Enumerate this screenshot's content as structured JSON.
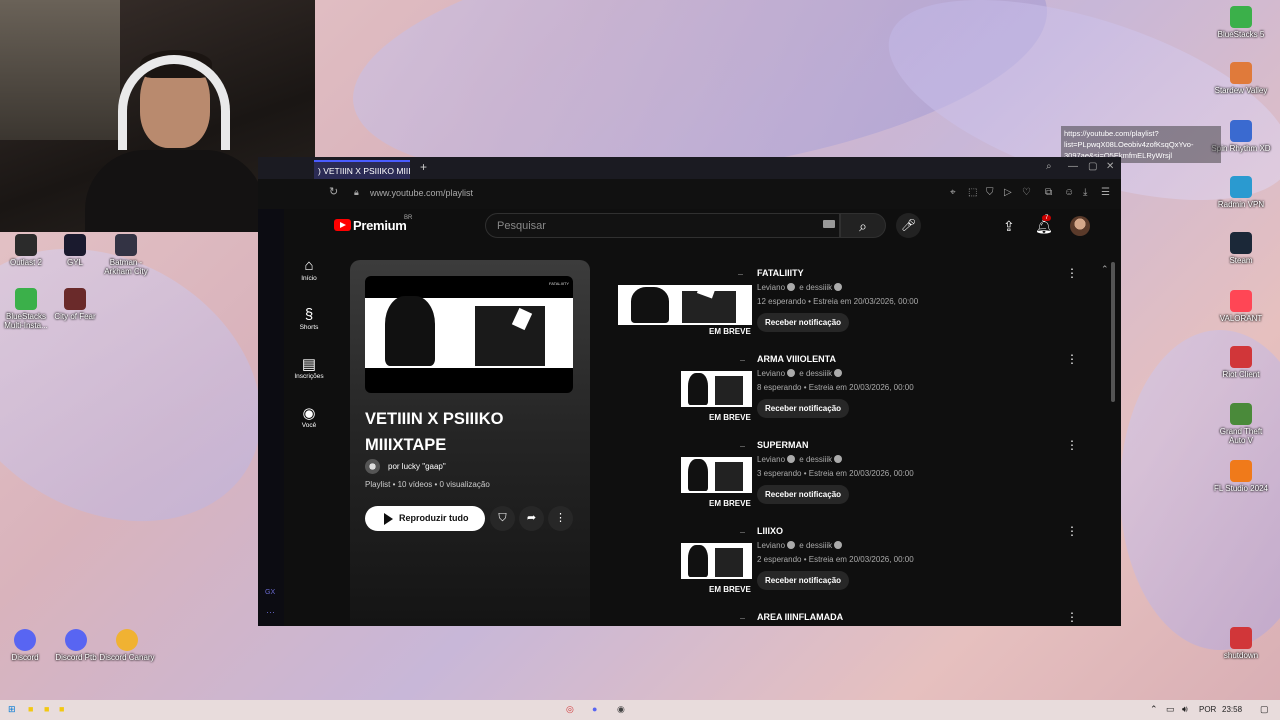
{
  "webcam": {
    "label": "webcam overlay"
  },
  "desktop_icons_left": [
    {
      "label": "Outlast 2",
      "icon": "outlast-icon",
      "color": "#2b2b2b"
    },
    {
      "label": "GYL",
      "icon": "gyl-icon",
      "color": "#1a1a2e"
    },
    {
      "label": "Batman - Arkham City",
      "icon": "batman-icon",
      "color": "#333344"
    },
    {
      "label": "BlueStacks Multi-Insta...",
      "icon": "bluestacks-icon",
      "color": "#3bb04a"
    },
    {
      "label": "City of Fear",
      "icon": "city-of-fear-icon",
      "color": "#6a2a2a"
    }
  ],
  "desktop_icons_left_bottom": [
    {
      "label": "Discord",
      "icon": "discord-icon",
      "color": "#5865f2"
    },
    {
      "label": "Discord Ptb",
      "icon": "discord-ptb-icon",
      "color": "#5865f2"
    },
    {
      "label": "Discord Canary",
      "icon": "discord-canary-icon",
      "color": "#f0b232"
    }
  ],
  "desktop_icons_right": [
    {
      "label": "BlueStacks 5",
      "icon": "bluestacks-icon",
      "color": "#3bb04a"
    },
    {
      "label": "Stardew Valley",
      "icon": "stardew-icon",
      "color": "#e07a3a"
    },
    {
      "label": "Spin Rhythm XD",
      "icon": "spin-rhythm-icon",
      "color": "#3a6ad0"
    },
    {
      "label": "Radmin VPN",
      "icon": "radmin-icon",
      "color": "#2a9ad0"
    },
    {
      "label": "Steam",
      "icon": "steam-icon",
      "color": "#1b2838"
    },
    {
      "label": "VALORANT",
      "icon": "valorant-icon",
      "color": "#ff4655"
    },
    {
      "label": "Riot Client",
      "icon": "riot-icon",
      "color": "#d13639"
    },
    {
      "label": "Grand Theft Auto V",
      "icon": "gta-icon",
      "color": "#4a8a3a"
    },
    {
      "label": "FL Studio 2024",
      "icon": "fl-studio-icon",
      "color": "#f07a1a"
    },
    {
      "label": "shutdown",
      "icon": "shutdown-icon",
      "color": "#d13639"
    }
  ],
  "browser": {
    "tab_title": ") VETIIIN X PSIIIKO MIIIX",
    "url": "www.youtube.com/playlist",
    "link_tooltip": "https://youtube.com/playlist?list=PLpwqX08LOeobiv4zofKsqQxYvo-3097ae&si=Q5EkmfmELRyWrsjl",
    "gx_label": "GX"
  },
  "yt": {
    "logo_text": "Premium",
    "logo_region": "BR",
    "search_placeholder": "Pesquisar",
    "notification_count": "7",
    "nav": [
      {
        "label": "Início",
        "icon": "home-icon"
      },
      {
        "label": "Shorts",
        "icon": "shorts-icon"
      },
      {
        "label": "Inscrições",
        "icon": "subscriptions-icon"
      },
      {
        "label": "Você",
        "icon": "you-icon"
      }
    ],
    "playlist": {
      "title": "VETIIIN X PSIIIKO MIIIXTAPE",
      "thumb_tag": "FATALIIITY",
      "owner": "por lucky \"gaap\"",
      "meta": "Playlist • 10 vídeos • 0 visualização",
      "play_all": "Reproduzir tudo"
    },
    "videos": [
      {
        "title": "FATALIIITY",
        "channel": "Leviano",
        "collab": "e dessiiik",
        "waiting": "12 esperando • Estreia em 20/03/2026, 00:00",
        "soon": "EM BREVE",
        "notify": "Receber notificação"
      },
      {
        "title": "ARMA VIIIOLENTA",
        "channel": "Leviano",
        "collab": "e dessiiik",
        "waiting": "8 esperando • Estreia em 20/03/2026, 00:00",
        "soon": "EM BREVE",
        "notify": "Receber notificação"
      },
      {
        "title": "SUPERMAN",
        "channel": "Leviano",
        "collab": "e dessiiik",
        "waiting": "3 esperando • Estreia em 20/03/2026, 00:00",
        "soon": "EM BREVE",
        "notify": "Receber notificação"
      },
      {
        "title": "LIIIXO",
        "channel": "Leviano",
        "collab": "e dessiiik",
        "waiting": "2 esperando • Estreia em 20/03/2026, 00:00",
        "soon": "EM BREVE",
        "notify": "Receber notificação"
      },
      {
        "title": "AREA IIINFLAMADA",
        "channel": "",
        "collab": "",
        "waiting": "",
        "soon": "",
        "notify": ""
      }
    ]
  },
  "taskbar": {
    "language": "POR",
    "time": "23:58"
  }
}
